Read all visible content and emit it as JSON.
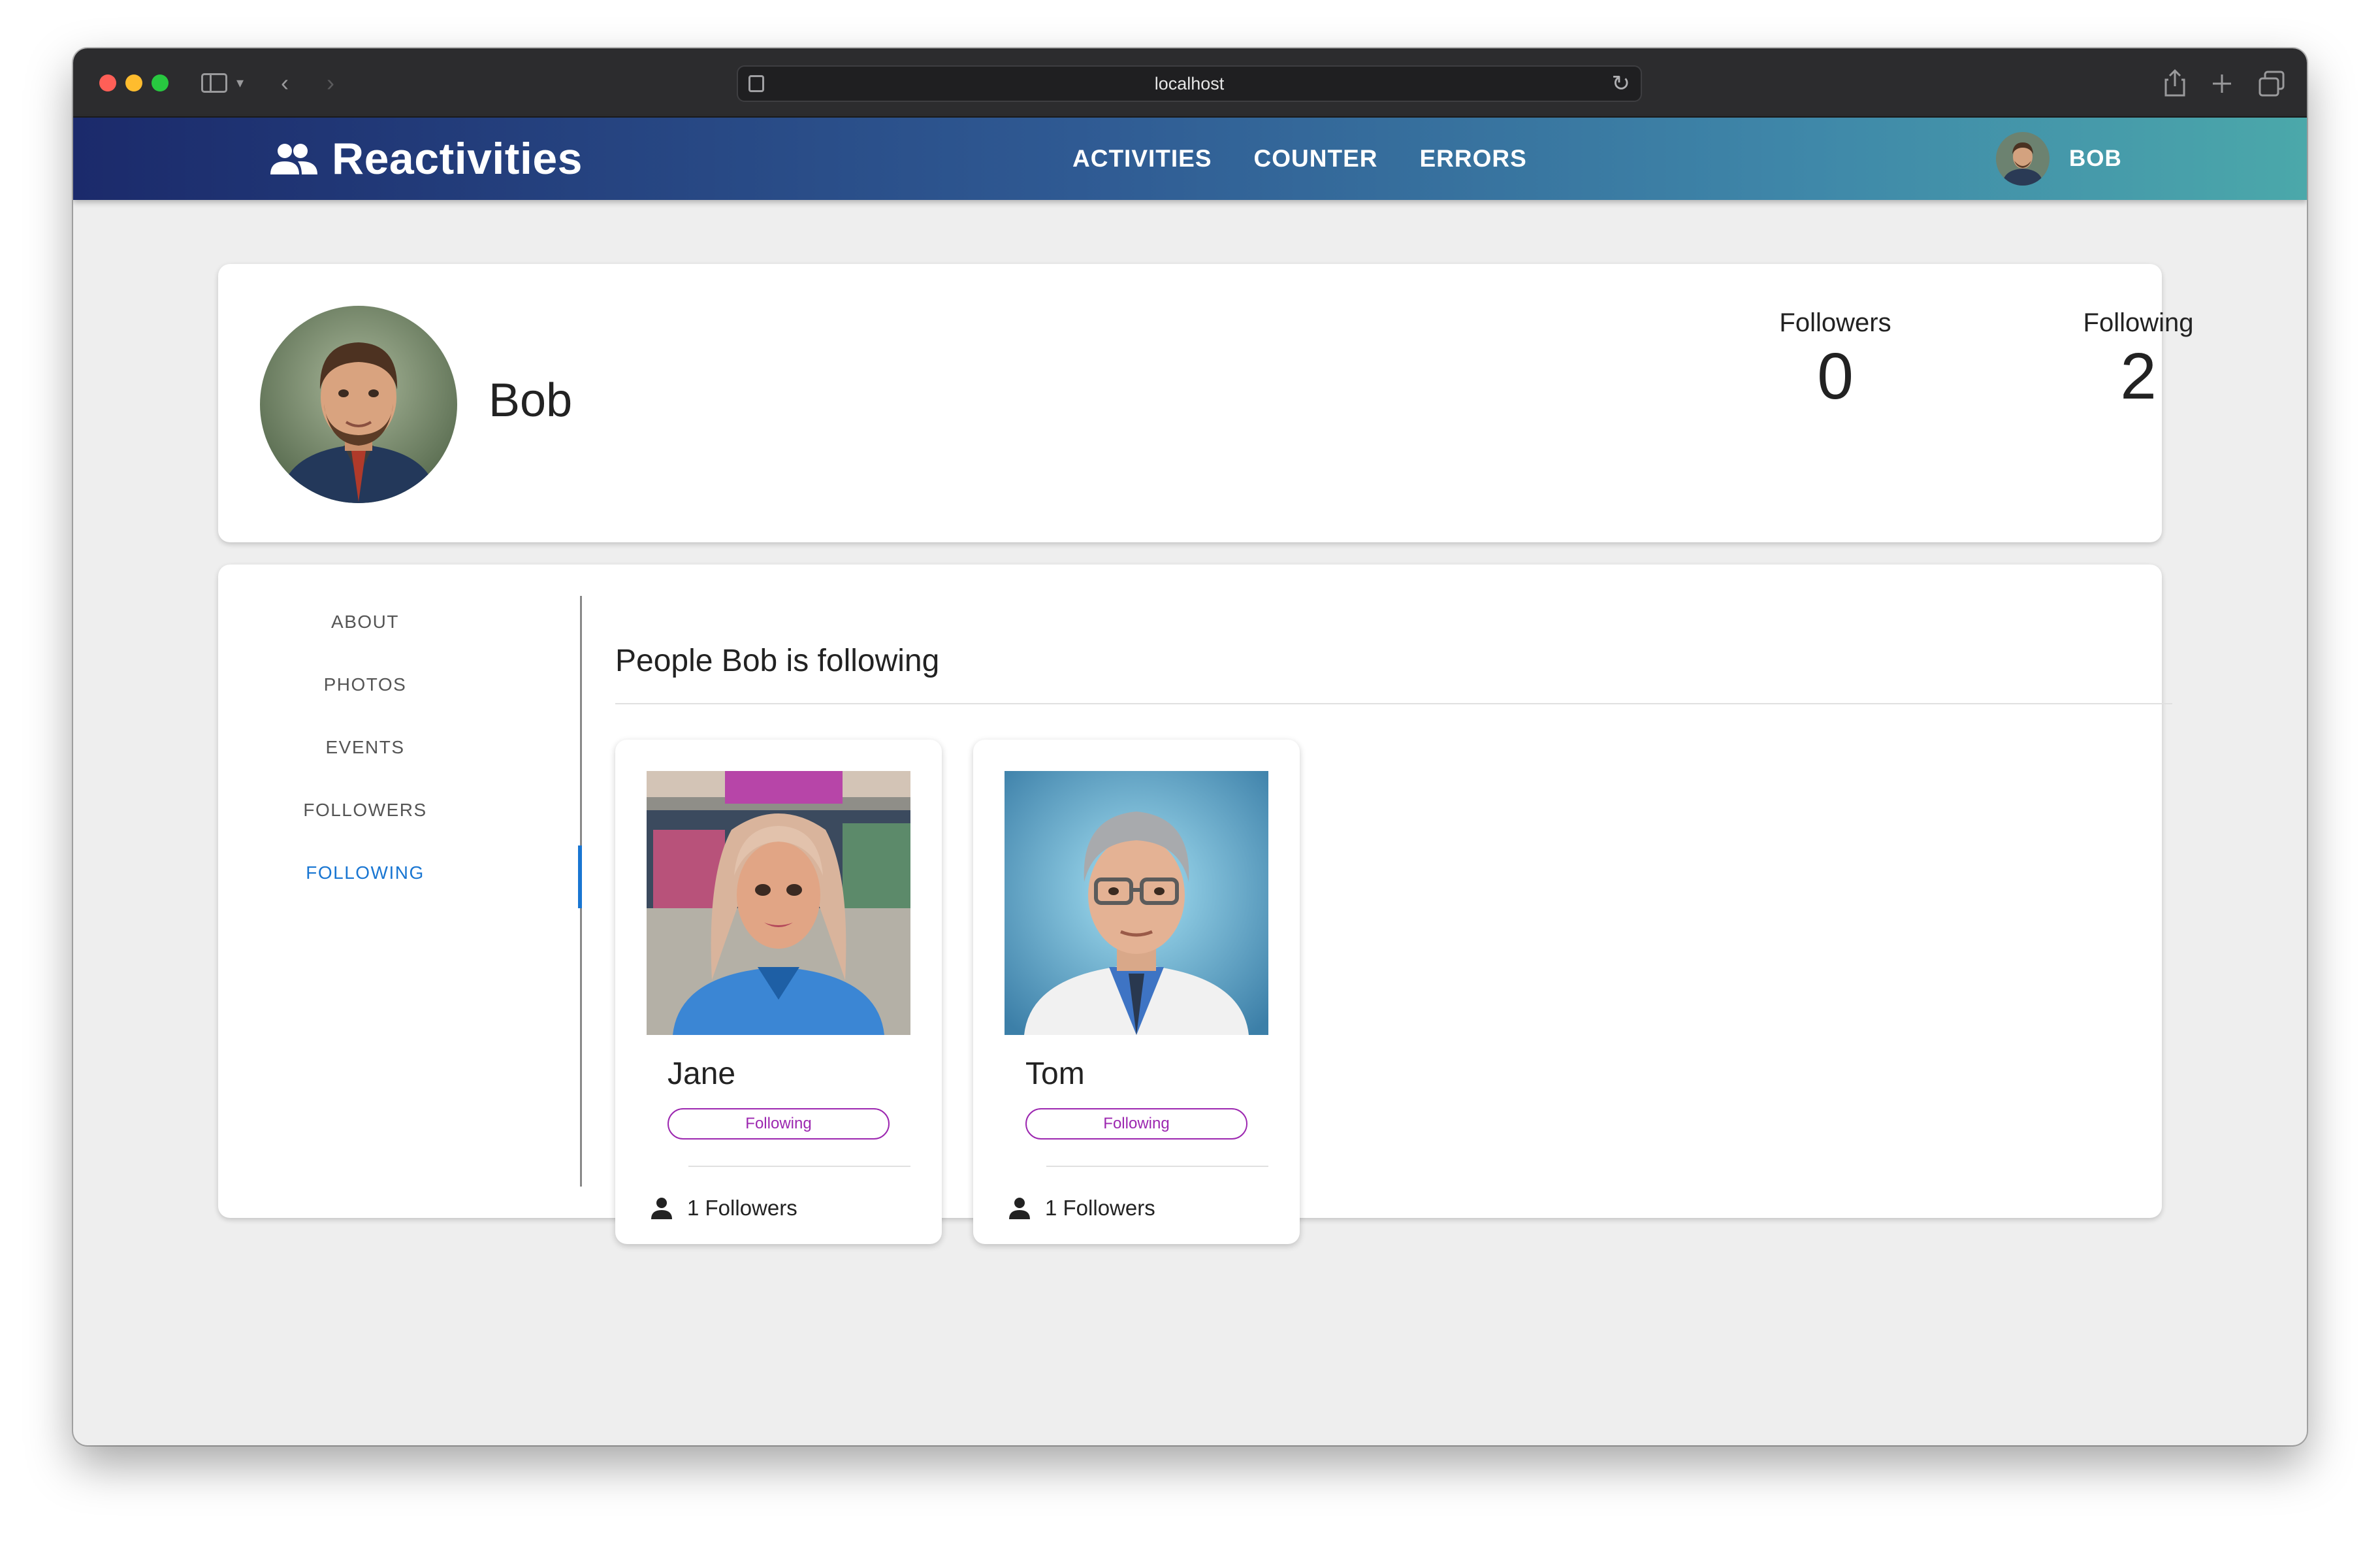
{
  "browser": {
    "url": "localhost"
  },
  "appbar": {
    "brand": "Reactivities",
    "nav": [
      "ACTIVITIES",
      "COUNTER",
      "ERRORS"
    ],
    "user_name": "BOB"
  },
  "profile": {
    "name": "Bob",
    "stats": [
      {
        "label": "Followers",
        "value": "0"
      },
      {
        "label": "Following",
        "value": "2"
      }
    ]
  },
  "tabs": {
    "items": [
      "ABOUT",
      "PHOTOS",
      "EVENTS",
      "FOLLOWERS",
      "FOLLOWING"
    ],
    "active": "FOLLOWING"
  },
  "following": {
    "title": "People Bob is following",
    "cards": [
      {
        "name": "Jane",
        "chip": "Following",
        "followers": "1 Followers"
      },
      {
        "name": "Tom",
        "chip": "Following",
        "followers": "1 Followers"
      }
    ]
  },
  "colors": {
    "accent": "#1976d2",
    "chip": "#9c27b0",
    "appbar_start": "#1b2a6b",
    "appbar_end": "#4ba8aa"
  },
  "icons": {
    "brand": "group-icon",
    "followers": "person-icon"
  }
}
